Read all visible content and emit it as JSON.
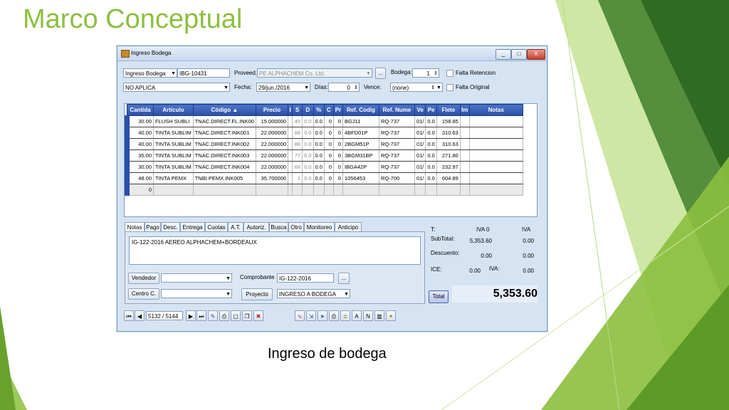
{
  "slide": {
    "title": "Marco Conceptual",
    "caption": "Ingreso de bodega"
  },
  "window": {
    "title": "Ingreso Bodega",
    "controls": {
      "min": "_",
      "max": "□",
      "close": "X"
    }
  },
  "form": {
    "doc_type": "Ingreso Bodega",
    "doc_number": "IBG-10431",
    "aplica": "NO APLICA",
    "proveedor_label": "Proveed.",
    "proveedor": "PE ALPHACHEM Co. Ltd.",
    "proveedor_btn": "...",
    "fecha_label": "Fecha:",
    "fecha": "29/jun./2016",
    "dias_label": "Días:",
    "dias": "0",
    "vence_label": "Vence:",
    "vence": "(none)",
    "bodega_label": "Bodega:",
    "bodega": "1",
    "falta_retencion": "Falta Retencion",
    "falta_original": "Falta Original"
  },
  "grid": {
    "columns": [
      "Cantida",
      "Artículo",
      "Código",
      "Precio",
      "I",
      "S",
      "D",
      "%",
      "C",
      "Pr",
      "Ref. Codig",
      "Ref. Nume",
      "Ve",
      "Pe",
      "Flete",
      "Im",
      "Notas"
    ],
    "sort_indicator": "▲",
    "rows": [
      {
        "cantidad": "30.00",
        "articulo": "FLUSH SUBLI",
        "codigo": "TNAC.DIRECT.FL.INK00",
        "precio": "15.000000",
        "s": "45",
        "d": "0.0",
        "p": "0.0",
        "c": "0",
        "pr": "0",
        "refc": "BGJ11",
        "refn": "RQ-737",
        "ve": "01/",
        "pe": "0.0",
        "flete": "158.85"
      },
      {
        "cantidad": "40.00",
        "articulo": "TINTA SUBLIM",
        "codigo": "TNAC.DIRECT.INK001",
        "precio": "22.000000",
        "s": "88",
        "d": "0.0",
        "p": "0.0",
        "c": "0",
        "pr": "0",
        "refc": "4BFD01P",
        "refn": "RQ-737",
        "ve": "01/",
        "pe": "0.0",
        "flete": "310.63"
      },
      {
        "cantidad": "40.00",
        "articulo": "TINTA SUBLIM",
        "codigo": "TNAC.DIRECT.INK002",
        "precio": "22.000000",
        "s": "88",
        "d": "0.0",
        "p": "0.0",
        "c": "0",
        "pr": "0",
        "refc": "2BGM51P",
        "refn": "RQ-737",
        "ve": "01/",
        "pe": "0.0",
        "flete": "310.63"
      },
      {
        "cantidad": "35.00",
        "articulo": "TINTA SUBLIM",
        "codigo": "TNAC.DIRECT.INK003",
        "precio": "22.000000",
        "s": "77",
        "d": "0.0",
        "p": "0.0",
        "c": "0",
        "pr": "0",
        "refc": "3BGM31BP",
        "refn": "RQ-737",
        "ve": "01/",
        "pe": "0.0",
        "flete": "271.80"
      },
      {
        "cantidad": "30.00",
        "articulo": "TINTA SUBLIM",
        "codigo": "TNAC.DIRECT.INK004",
        "precio": "22.000000",
        "s": "66",
        "d": "0.0",
        "p": "0.0",
        "c": "0",
        "pr": "0",
        "refc": "IBGA42P",
        "refn": "RQ-737",
        "ve": "01/",
        "pe": "0.0",
        "flete": "232.97"
      },
      {
        "cantidad": "48.00",
        "articulo": "TINTA PEMX",
        "codigo": "TNBI.PEMX.INK005",
        "precio": "35.700000",
        "s": "1",
        "d": "0.0",
        "p": "0.0",
        "c": "0",
        "pr": "0",
        "refc": "1056453",
        "refn": "RQ-700",
        "ve": "01/",
        "pe": "0.0",
        "flete": "604.89"
      }
    ],
    "new_row_value": "0"
  },
  "tabs": [
    "Notas",
    "Pago",
    "Desc.",
    "Entrega",
    "Cuotas",
    "A.T.",
    "Autoriz.",
    "Busca",
    "Otro",
    "Monitoreo",
    "Anticipo"
  ],
  "notes": {
    "text": "IG-122-2016 AEREO ALPHACHEM+BORDEAUX",
    "vendedor_btn": "Vendedor",
    "centro_btn": "Centro C.",
    "comprobante_label": "Comprobante",
    "comprobante": "IG-122-2016",
    "comprobante_btn": "...",
    "proyecto_btn": "Proyecto",
    "proyecto": "INGRESO A BODEGA"
  },
  "totals": {
    "t_label": "T:",
    "iva0_label": "IVA 0",
    "iva_label": "IVA",
    "subtotal_label": "SubTotal:",
    "subtotal_iva0": "5,353.60",
    "subtotal_iva": "0.00",
    "descuento_label": "Descuento:",
    "descuento_iva0": "0.00",
    "descuento_iva": "0.00",
    "ice_label": "ICE:",
    "ice": "0.00",
    "iva2_label": "IVA:",
    "iva_value": "0.00",
    "total_btn": "Total",
    "total": "5,353.60"
  },
  "nav": {
    "record": "5132 / 5144"
  }
}
